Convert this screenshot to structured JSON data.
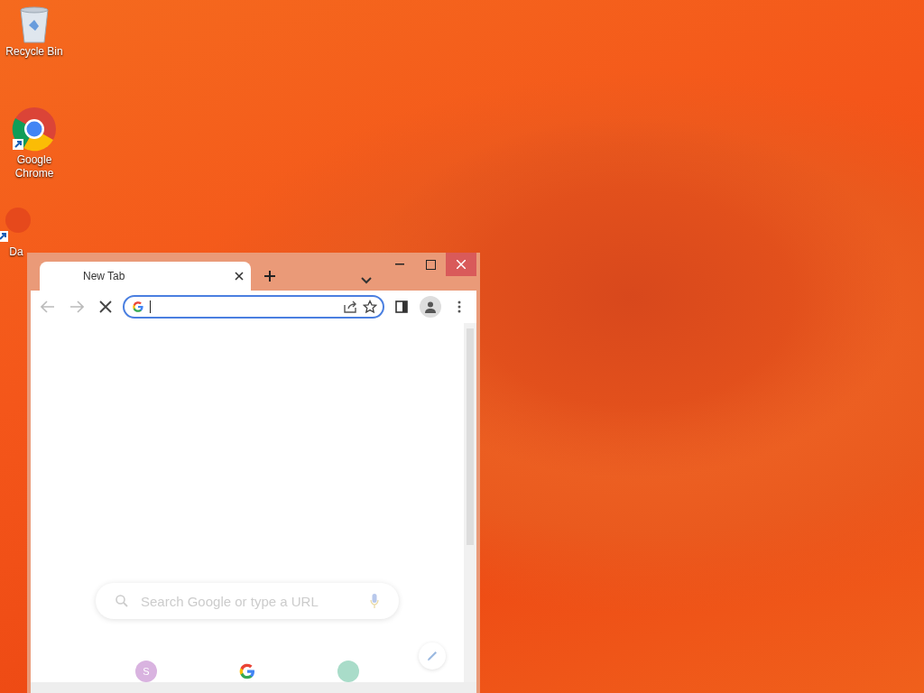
{
  "desktop": {
    "icons": [
      {
        "kind": "recycle-bin",
        "label": "Recycle Bin"
      },
      {
        "kind": "chrome",
        "label": "Google Chrome"
      },
      {
        "kind": "app",
        "label": "Da"
      }
    ]
  },
  "browser": {
    "tabs": [
      {
        "title": "New Tab",
        "selected": true
      }
    ],
    "address": {
      "focused": true
    },
    "search": {
      "placeholder": "Search Google or type a URL"
    },
    "shortcuts": [
      {
        "kind": "letter",
        "letter": "S",
        "color": "#d9b3e0"
      },
      {
        "kind": "google"
      },
      {
        "kind": "blank",
        "color": "#a9dcc9"
      }
    ]
  }
}
